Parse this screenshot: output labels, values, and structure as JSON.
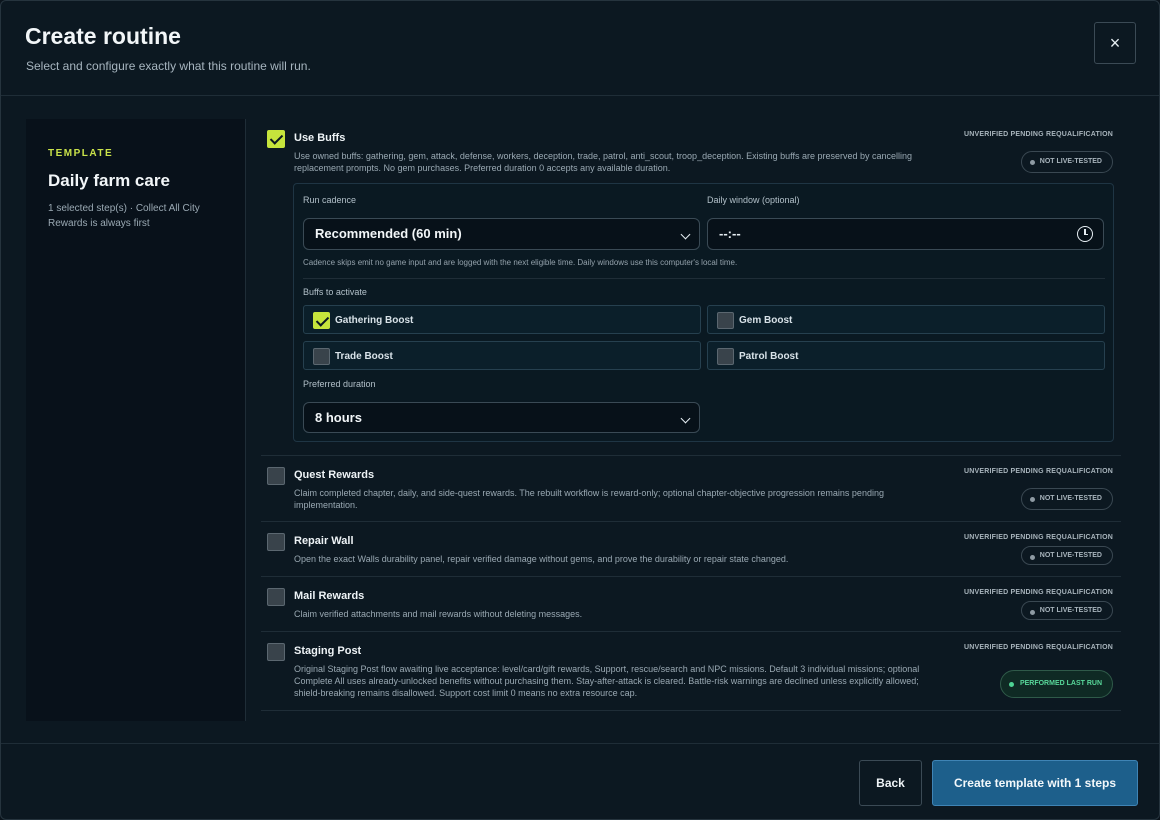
{
  "header": {
    "title": "Create routine",
    "subtitle": "Select and configure exactly what this routine will run.",
    "close_label": "×"
  },
  "template": {
    "kicker": "TEMPLATE",
    "name": "Daily farm care",
    "meta": "1 selected step(s) · Collect All City Rewards is always first"
  },
  "steps": [
    {
      "title": "Use Buffs",
      "checked": true,
      "desc": "Use owned buffs: gathering, gem, attack, defense, workers, deception, trade, patrol, anti_scout, troop_deception. Existing buffs are preserved by cancelling replacement prompts. No gem purchases. Preferred duration 0 accepts any available duration.",
      "state": "UNVERIFIED PENDING REQUALIFICATION",
      "badge": "NOT LIVE-TESTED"
    },
    {
      "title": "Quest Rewards",
      "checked": false,
      "desc": "Claim completed chapter, daily, and side-quest rewards. The rebuilt workflow is reward-only; optional chapter-objective progression remains pending implementation.",
      "state": "UNVERIFIED PENDING REQUALIFICATION",
      "badge": "NOT LIVE-TESTED"
    },
    {
      "title": "Repair Wall",
      "checked": false,
      "desc": "Open the exact Walls durability panel, repair verified damage without gems, and prove the durability or repair state changed.",
      "state": "UNVERIFIED PENDING REQUALIFICATION",
      "badge": "NOT LIVE-TESTED"
    },
    {
      "title": "Mail Rewards",
      "checked": false,
      "desc": "Claim verified attachments and mail rewards without deleting messages.",
      "state": "UNVERIFIED PENDING REQUALIFICATION",
      "badge": "NOT LIVE-TESTED"
    },
    {
      "title": "Staging Post",
      "checked": false,
      "desc": "Original Staging Post flow awaiting live acceptance: level/card/gift rewards, Support, rescue/search and NPC missions. Default 3 individual missions; optional Complete All uses already-unlocked benefits without purchasing them. Stay-after-attack is cleared. Battle-risk warnings are declined unless explicitly allowed; shield-breaking remains disallowed. Support cost limit 0 means no extra resource cap.",
      "state": "UNVERIFIED PENDING REQUALIFICATION",
      "badge": "PERFORMED LAST RUN"
    }
  ],
  "config": {
    "cadence_label": "Run cadence",
    "cadence_value": "Recommended (60 min)",
    "window_label": "Daily window (optional)",
    "window_value": "--:--",
    "hint": "Cadence skips emit no game input and are logged with the next eligible time. Daily windows use this computer's local time.",
    "buffs_label": "Buffs to activate",
    "buffs": [
      {
        "label": "Gathering Boost",
        "checked": true
      },
      {
        "label": "Gem Boost",
        "checked": false
      },
      {
        "label": "Trade Boost",
        "checked": false
      },
      {
        "label": "Patrol Boost",
        "checked": false
      }
    ],
    "duration_label": "Preferred duration",
    "duration_value": "8 hours"
  },
  "footer": {
    "back_label": "Back",
    "create_label": "Create template with 1 steps"
  },
  "colors": {
    "accent_lime": "#c6e43c",
    "primary_button": "#1d5f8b",
    "success_green": "#58d89a"
  }
}
